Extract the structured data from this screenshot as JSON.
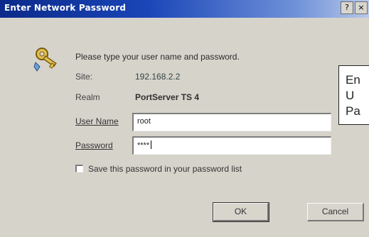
{
  "window": {
    "title": "Enter Network Password",
    "help_button": "?",
    "close_button": "×"
  },
  "dialog": {
    "instruction": "Please type your user name and password.",
    "site_label": "Site:",
    "site_value": "192.168.2.2",
    "realm_label": "Realm",
    "realm_value": "PortServer TS 4",
    "username_label": "User Name",
    "username_value": "root",
    "password_label": "Password",
    "password_value": "****",
    "save_password_label": "Save this password in your password list",
    "save_password_checked": false,
    "ok_label": "OK",
    "cancel_label": "Cancel"
  },
  "callout": {
    "lines": [
      "En",
      "U",
      "Pa"
    ]
  },
  "icons": {
    "key": "key-icon",
    "help": "help-icon",
    "close": "close-icon"
  },
  "colors": {
    "titlebar_start": "#0b2a8a",
    "titlebar_end": "#b7c8ea",
    "dialog_bg": "#d6d3cb"
  }
}
